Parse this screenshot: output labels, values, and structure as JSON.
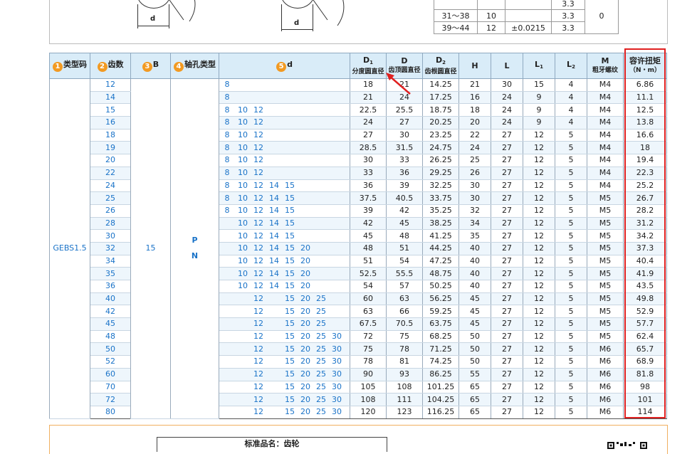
{
  "top_figure": {
    "dim_label_1": "d",
    "dim_label_2": "d"
  },
  "top_table": {
    "rows": [
      {
        "range": "",
        "a": "",
        "tol": "",
        "b": "3.3"
      },
      {
        "range": "31～38",
        "a": "10",
        "tol": "",
        "b": "3.3"
      },
      {
        "range": "39～44",
        "a": "12",
        "tol": "±0.0215",
        "b": "3.3"
      }
    ],
    "merged": "0"
  },
  "table": {
    "headers": {
      "type_code": "类型码",
      "type_code_num": "1",
      "teeth": "齿数",
      "teeth_num": "2",
      "b": "B",
      "b_num": "3",
      "bore_type": "轴孔类型",
      "bore_type_num": "4",
      "d": "d",
      "d_num": "5",
      "D1_main": "D",
      "D1_sub": "1",
      "D1_desc": "分度圆直径",
      "D_main": "D",
      "D_desc": "齿顶圆直径",
      "D2_main": "D",
      "D2_sub": "2",
      "D2_desc": "齿根圆直径",
      "H": "H",
      "L": "L",
      "L1_main": "L",
      "L1_sub": "1",
      "L2_main": "L",
      "L2_sub": "2",
      "M_main": "M",
      "M_desc": "粗牙螺纹",
      "torque": "容许扭矩",
      "torque_unit": "（N・m）"
    },
    "type_code": "GEBS1.5",
    "b_value": "15",
    "bore_types": [
      "P",
      "N"
    ],
    "rows": [
      {
        "z": "12",
        "d": [
          "8",
          "",
          "",
          "",
          "",
          "",
          ""
        ],
        "D1": "18",
        "D": "21",
        "D2": "14.25",
        "H": "21",
        "L": "30",
        "L1": "15",
        "L2": "4",
        "M": "M4",
        "T": "6.86"
      },
      {
        "z": "14",
        "d": [
          "8",
          "",
          "",
          "",
          "",
          "",
          ""
        ],
        "D1": "21",
        "D": "24",
        "D2": "17.25",
        "H": "16",
        "L": "24",
        "L1": "9",
        "L2": "4",
        "M": "M4",
        "T": "11.1"
      },
      {
        "z": "15",
        "d": [
          "8",
          "10",
          "12",
          "",
          "",
          "",
          ""
        ],
        "D1": "22.5",
        "D": "25.5",
        "D2": "18.75",
        "H": "18",
        "L": "24",
        "L1": "9",
        "L2": "4",
        "M": "M4",
        "T": "12.5"
      },
      {
        "z": "16",
        "d": [
          "8",
          "10",
          "12",
          "",
          "",
          "",
          ""
        ],
        "D1": "24",
        "D": "27",
        "D2": "20.25",
        "H": "20",
        "L": "24",
        "L1": "9",
        "L2": "4",
        "M": "M4",
        "T": "13.8"
      },
      {
        "z": "18",
        "d": [
          "8",
          "10",
          "12",
          "",
          "",
          "",
          ""
        ],
        "D1": "27",
        "D": "30",
        "D2": "23.25",
        "H": "22",
        "L": "27",
        "L1": "12",
        "L2": "5",
        "M": "M4",
        "T": "16.6"
      },
      {
        "z": "19",
        "d": [
          "8",
          "10",
          "12",
          "",
          "",
          "",
          ""
        ],
        "D1": "28.5",
        "D": "31.5",
        "D2": "24.75",
        "H": "24",
        "L": "27",
        "L1": "12",
        "L2": "5",
        "M": "M4",
        "T": "18"
      },
      {
        "z": "20",
        "d": [
          "8",
          "10",
          "12",
          "",
          "",
          "",
          ""
        ],
        "D1": "30",
        "D": "33",
        "D2": "26.25",
        "H": "25",
        "L": "27",
        "L1": "12",
        "L2": "5",
        "M": "M4",
        "T": "19.4"
      },
      {
        "z": "22",
        "d": [
          "8",
          "10",
          "12",
          "",
          "",
          "",
          ""
        ],
        "D1": "33",
        "D": "36",
        "D2": "29.25",
        "H": "26",
        "L": "27",
        "L1": "12",
        "L2": "5",
        "M": "M4",
        "T": "22.3"
      },
      {
        "z": "24",
        "d": [
          "8",
          "10",
          "12",
          "14",
          "15",
          "",
          ""
        ],
        "D1": "36",
        "D": "39",
        "D2": "32.25",
        "H": "30",
        "L": "27",
        "L1": "12",
        "L2": "5",
        "M": "M4",
        "T": "25.2"
      },
      {
        "z": "25",
        "d": [
          "8",
          "10",
          "12",
          "14",
          "15",
          "",
          ""
        ],
        "D1": "37.5",
        "D": "40.5",
        "D2": "33.75",
        "H": "30",
        "L": "27",
        "L1": "12",
        "L2": "5",
        "M": "M5",
        "T": "26.7"
      },
      {
        "z": "26",
        "d": [
          "8",
          "10",
          "12",
          "14",
          "15",
          "",
          ""
        ],
        "D1": "39",
        "D": "42",
        "D2": "35.25",
        "H": "32",
        "L": "27",
        "L1": "12",
        "L2": "5",
        "M": "M5",
        "T": "28.2"
      },
      {
        "z": "28",
        "d": [
          "",
          "10",
          "12",
          "14",
          "15",
          "",
          ""
        ],
        "D1": "42",
        "D": "45",
        "D2": "38.25",
        "H": "34",
        "L": "27",
        "L1": "12",
        "L2": "5",
        "M": "M5",
        "T": "31.2"
      },
      {
        "z": "30",
        "d": [
          "",
          "10",
          "12",
          "14",
          "15",
          "",
          ""
        ],
        "D1": "45",
        "D": "48",
        "D2": "41.25",
        "H": "35",
        "L": "27",
        "L1": "12",
        "L2": "5",
        "M": "M5",
        "T": "34.2"
      },
      {
        "z": "32",
        "d": [
          "",
          "10",
          "12",
          "14",
          "15",
          "20",
          ""
        ],
        "D1": "48",
        "D": "51",
        "D2": "44.25",
        "H": "40",
        "L": "27",
        "L1": "12",
        "L2": "5",
        "M": "M5",
        "T": "37.3"
      },
      {
        "z": "34",
        "d": [
          "",
          "10",
          "12",
          "14",
          "15",
          "20",
          ""
        ],
        "D1": "51",
        "D": "54",
        "D2": "47.25",
        "H": "40",
        "L": "27",
        "L1": "12",
        "L2": "5",
        "M": "M5",
        "T": "40.4"
      },
      {
        "z": "35",
        "d": [
          "",
          "10",
          "12",
          "14",
          "15",
          "20",
          ""
        ],
        "D1": "52.5",
        "D": "55.5",
        "D2": "48.75",
        "H": "40",
        "L": "27",
        "L1": "12",
        "L2": "5",
        "M": "M5",
        "T": "41.9"
      },
      {
        "z": "36",
        "d": [
          "",
          "10",
          "12",
          "14",
          "15",
          "20",
          ""
        ],
        "D1": "54",
        "D": "57",
        "D2": "50.25",
        "H": "40",
        "L": "27",
        "L1": "12",
        "L2": "5",
        "M": "M5",
        "T": "43.5"
      },
      {
        "z": "40",
        "d": [
          "",
          "",
          "12",
          "",
          "15",
          "20",
          "25"
        ],
        "D1": "60",
        "D": "63",
        "D2": "56.25",
        "H": "45",
        "L": "27",
        "L1": "12",
        "L2": "5",
        "M": "M5",
        "T": "49.8"
      },
      {
        "z": "42",
        "d": [
          "",
          "",
          "12",
          "",
          "15",
          "20",
          "25"
        ],
        "D1": "63",
        "D": "66",
        "D2": "59.25",
        "H": "45",
        "L": "27",
        "L1": "12",
        "L2": "5",
        "M": "M5",
        "T": "52.9"
      },
      {
        "z": "45",
        "d": [
          "",
          "",
          "12",
          "",
          "15",
          "20",
          "25"
        ],
        "D1": "67.5",
        "D": "70.5",
        "D2": "63.75",
        "H": "45",
        "L": "27",
        "L1": "12",
        "L2": "5",
        "M": "M5",
        "T": "57.7"
      },
      {
        "z": "48",
        "d": [
          "",
          "",
          "12",
          "",
          "15",
          "20",
          "25",
          "30"
        ],
        "D1": "72",
        "D": "75",
        "D2": "68.25",
        "H": "50",
        "L": "27",
        "L1": "12",
        "L2": "5",
        "M": "M5",
        "T": "62.4"
      },
      {
        "z": "50",
        "d": [
          "",
          "",
          "12",
          "",
          "15",
          "20",
          "25",
          "30"
        ],
        "D1": "75",
        "D": "78",
        "D2": "71.25",
        "H": "50",
        "L": "27",
        "L1": "12",
        "L2": "5",
        "M": "M6",
        "T": "65.7"
      },
      {
        "z": "52",
        "d": [
          "",
          "",
          "12",
          "",
          "15",
          "20",
          "25",
          "30"
        ],
        "D1": "78",
        "D": "81",
        "D2": "74.25",
        "H": "50",
        "L": "27",
        "L1": "12",
        "L2": "5",
        "M": "M6",
        "T": "68.9"
      },
      {
        "z": "60",
        "d": [
          "",
          "",
          "12",
          "",
          "15",
          "20",
          "25",
          "30"
        ],
        "D1": "90",
        "D": "93",
        "D2": "86.25",
        "H": "55",
        "L": "27",
        "L1": "12",
        "L2": "5",
        "M": "M6",
        "T": "81.8"
      },
      {
        "z": "70",
        "d": [
          "",
          "",
          "12",
          "",
          "15",
          "20",
          "25",
          "30"
        ],
        "D1": "105",
        "D": "108",
        "D2": "101.25",
        "H": "65",
        "L": "27",
        "L1": "12",
        "L2": "5",
        "M": "M6",
        "T": "98"
      },
      {
        "z": "72",
        "d": [
          "",
          "",
          "12",
          "",
          "15",
          "20",
          "25",
          "30"
        ],
        "D1": "108",
        "D": "111",
        "D2": "104.25",
        "H": "65",
        "L": "27",
        "L1": "12",
        "L2": "5",
        "M": "M6",
        "T": "101"
      },
      {
        "z": "80",
        "d": [
          "",
          "",
          "12",
          "",
          "15",
          "20",
          "25",
          "30"
        ],
        "D1": "120",
        "D": "123",
        "D2": "116.25",
        "H": "65",
        "L": "27",
        "L1": "12",
        "L2": "5",
        "M": "M6",
        "T": "114"
      }
    ]
  },
  "bottom": {
    "standard_name": "标准品名：齿轮"
  },
  "colors": {
    "header_bg": "#d9ecf8",
    "blue_text": "#1a73c8",
    "highlight": "#e02020",
    "badge": "#f29a22"
  }
}
